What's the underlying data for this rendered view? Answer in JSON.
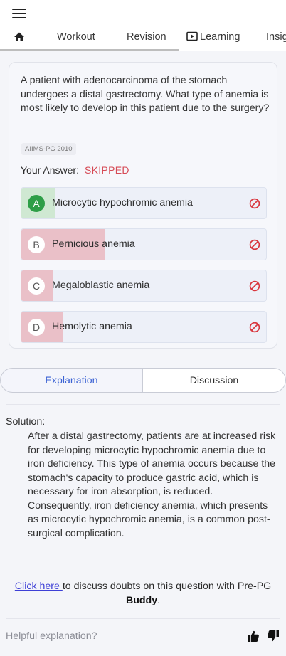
{
  "nav": {
    "tabs": [
      "Workout",
      "Revision",
      "Learning",
      "Insig"
    ]
  },
  "question": {
    "text": "A patient with adenocarcinoma of the stomach undergoes a distal gastrectomy. What type of anemia is most likely to develop in this patient due to the surgery?",
    "tag": "AIIMS-PG 2010",
    "your_answer_label": "Your Answer:",
    "your_answer_value": "SKIPPED"
  },
  "options": [
    {
      "letter": "A",
      "text": "Microcytic hypochromic anemia",
      "correct": true,
      "response_share_pct": 14
    },
    {
      "letter": "B",
      "text": "Pernicious anemia",
      "correct": false,
      "response_share_pct": 34
    },
    {
      "letter": "C",
      "text": "Megaloblastic anemia",
      "correct": false,
      "response_share_pct": 13
    },
    {
      "letter": "D",
      "text": "Hemolytic anemia",
      "correct": false,
      "response_share_pct": 17
    }
  ],
  "colors": {
    "correct_fill": "#cfe8d2",
    "correct_circle": "#2e9e47",
    "wrong_fill": "#eac0c8",
    "wrong_icon": "#d9363e",
    "accent": "#3b62d4"
  },
  "segment": {
    "explanation": "Explanation",
    "discussion": "Discussion"
  },
  "solution": {
    "label": "Solution:",
    "text": "After a distal gastrectomy, patients are at increased risk for developing microcytic hypochromic anemia due to iron deficiency. This type of anemia occurs because the stomach's capacity to produce gastric acid, which is necessary for iron absorption, is reduced. Consequently, iron deficiency anemia, which presents as microcytic hypochromic anemia, is a common post-surgical complication."
  },
  "doubts": {
    "link": "Click here ",
    "text": "to discuss doubts on this question with Pre-PG ",
    "bold": "Buddy",
    "end": "."
  },
  "feedback": {
    "label": "Helpful explanation?"
  }
}
